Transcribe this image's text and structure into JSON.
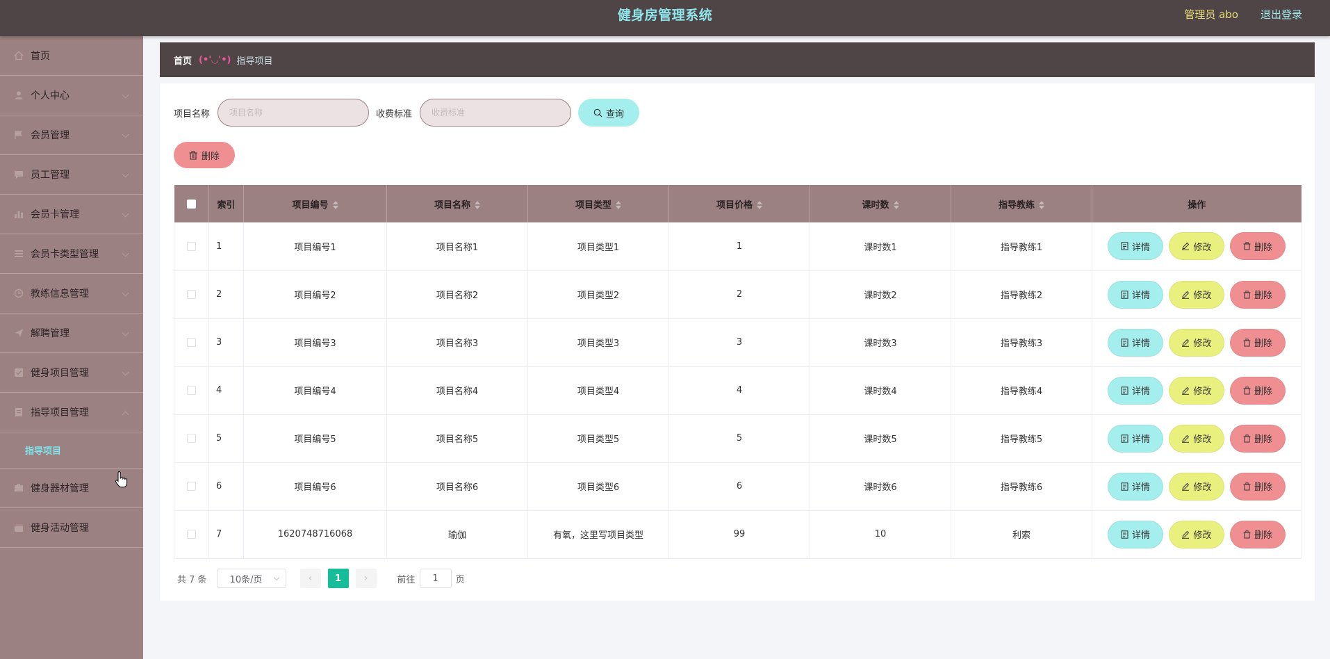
{
  "header": {
    "title": "健身房管理系统",
    "admin_label": "管理员 abo",
    "logout_label": "退出登录"
  },
  "sidebar": {
    "items": [
      {
        "label": "首页",
        "icon": "home-icon",
        "has_chevron": false
      },
      {
        "label": "个人中心",
        "icon": "user-icon",
        "has_chevron": true
      },
      {
        "label": "会员管理",
        "icon": "flag-icon",
        "has_chevron": true
      },
      {
        "label": "员工管理",
        "icon": "chat-icon",
        "has_chevron": true
      },
      {
        "label": "会员卡管理",
        "icon": "chart-icon",
        "has_chevron": true
      },
      {
        "label": "会员卡类型管理",
        "icon": "list-icon",
        "has_chevron": true
      },
      {
        "label": "教练信息管理",
        "icon": "clock-icon",
        "has_chevron": true
      },
      {
        "label": "解聘管理",
        "icon": "send-icon",
        "has_chevron": true
      },
      {
        "label": "健身项目管理",
        "icon": "checkbox-icon",
        "has_chevron": true
      },
      {
        "label": "指导项目管理",
        "icon": "document-icon",
        "has_chevron": true,
        "expanded": true
      },
      {
        "label": "健身器材管理",
        "icon": "box-icon",
        "has_chevron": false
      },
      {
        "label": "健身活动管理",
        "icon": "calendar-icon",
        "has_chevron": false
      }
    ],
    "submenu_active": "指导项目"
  },
  "breadcrumb": {
    "home": "首页",
    "face": "(•'◡'•)",
    "current": "指导项目"
  },
  "search": {
    "name_label": "项目名称",
    "name_placeholder": "项目名称",
    "fee_label": "收费标准",
    "fee_placeholder": "收费标准",
    "query_label": "查询"
  },
  "toolbar": {
    "delete_label": "删除"
  },
  "table": {
    "columns": [
      "索引",
      "项目编号",
      "项目名称",
      "项目类型",
      "项目价格",
      "课时数",
      "指导教练",
      "操作"
    ],
    "rows": [
      {
        "index": "1",
        "code": "项目编号1",
        "name": "项目名称1",
        "type": "项目类型1",
        "price": "1",
        "hours": "课时数1",
        "coach": "指导教练1"
      },
      {
        "index": "2",
        "code": "项目编号2",
        "name": "项目名称2",
        "type": "项目类型2",
        "price": "2",
        "hours": "课时数2",
        "coach": "指导教练2"
      },
      {
        "index": "3",
        "code": "项目编号3",
        "name": "项目名称3",
        "type": "项目类型3",
        "price": "3",
        "hours": "课时数3",
        "coach": "指导教练3"
      },
      {
        "index": "4",
        "code": "项目编号4",
        "name": "项目名称4",
        "type": "项目类型4",
        "price": "4",
        "hours": "课时数4",
        "coach": "指导教练4"
      },
      {
        "index": "5",
        "code": "项目编号5",
        "name": "项目名称5",
        "type": "项目类型5",
        "price": "5",
        "hours": "课时数5",
        "coach": "指导教练5"
      },
      {
        "index": "6",
        "code": "项目编号6",
        "name": "项目名称6",
        "type": "项目类型6",
        "price": "6",
        "hours": "课时数6",
        "coach": "指导教练6"
      },
      {
        "index": "7",
        "code": "1620748716068",
        "name": "瑜伽",
        "type": "有氧，这里写项目类型",
        "price": "99",
        "hours": "10",
        "coach": "利索"
      }
    ],
    "row_actions": {
      "detail": "详情",
      "edit": "修改",
      "delete": "删除"
    }
  },
  "pagination": {
    "total_text": "共 7 条",
    "page_size": "10条/页",
    "prev": "‹",
    "current_page": "1",
    "next": "›",
    "goto_prefix": "前往",
    "goto_value": "1",
    "goto_suffix": "页"
  },
  "colors": {
    "header_bg": "#4f4547",
    "sidebar_bg": "#9c8183",
    "title": "#8fe6ea",
    "detail_btn": "#a5eeee",
    "edit_btn": "#eaf07e",
    "delete_btn": "#ef8f92",
    "page_active": "#17bd98"
  }
}
